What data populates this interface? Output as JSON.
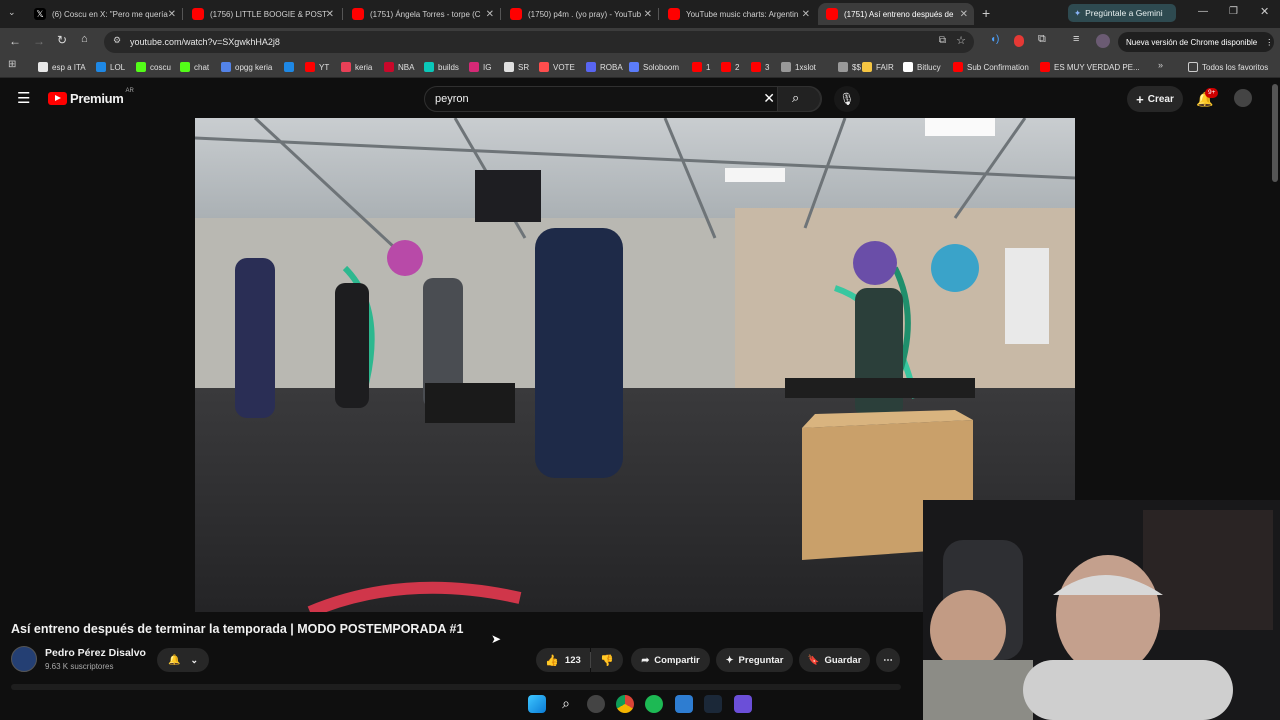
{
  "browser": {
    "tabs": [
      {
        "title": "(6) Coscu en X: \"Pero me quería",
        "favicon": "x-logo-icon"
      },
      {
        "title": "(1756) LITTLE BOOGIE & POST",
        "favicon": "youtube-icon"
      },
      {
        "title": "(1751) Ángela Torres - torpe (C",
        "favicon": "youtube-icon"
      },
      {
        "title": "(1750) p4m . (yo pray) - YouTub",
        "favicon": "youtube-icon"
      },
      {
        "title": "YouTube music charts: Argentin",
        "favicon": "youtube-icon"
      },
      {
        "title": "(1751) Así entreno después de",
        "favicon": "youtube-icon"
      }
    ],
    "gemini_label": "Pregúntale a Gemini",
    "url": "youtube.com/watch?v=SXgwkhHA2j8",
    "update_label": "Nueva versión de Chrome disponible",
    "bookmarks": [
      {
        "label": "esp a ITA",
        "color": "#e8e8e8"
      },
      {
        "label": "LOL",
        "color": "#1e88e5"
      },
      {
        "label": "coscu",
        "color": "#53fc18"
      },
      {
        "label": "chat",
        "color": "#53fc18"
      },
      {
        "label": "opgg keria",
        "color": "#5383e8"
      },
      {
        "label": "",
        "color": "#1e88e5"
      },
      {
        "label": "YT",
        "color": "#ff0000"
      },
      {
        "label": "keria",
        "color": "#e84057"
      },
      {
        "label": "NBA",
        "color": "#c9082a"
      },
      {
        "label": "builds",
        "color": "#0ac8b9"
      },
      {
        "label": "IG",
        "color": "#d62976"
      },
      {
        "label": "SR",
        "color": "#e0e0e0"
      },
      {
        "label": "VOTE",
        "color": "#ff4d4d"
      },
      {
        "label": "ROBA",
        "color": "#5865f2"
      },
      {
        "label": "Soloboom",
        "color": "#5b7cfa"
      },
      {
        "label": "1",
        "color": "#ff0000"
      },
      {
        "label": "2",
        "color": "#ff0000"
      },
      {
        "label": "3",
        "color": "#ff0000"
      },
      {
        "label": "1xslot",
        "color": "#999999"
      },
      {
        "label": "$$",
        "color": "#999999"
      },
      {
        "label": "FAIR",
        "color": "#f5c542"
      },
      {
        "label": "Bitlucy",
        "color": "#ffffff"
      },
      {
        "label": "Sub Confirmation",
        "color": "#ff0000"
      },
      {
        "label": "ES MUY VERDAD PE...",
        "color": "#ff0000"
      }
    ],
    "all_bookmarks_label": "Todos los favoritos"
  },
  "youtube": {
    "logo_text": "Premium",
    "logo_region": "AR",
    "search_value": "peyron",
    "create_label": "Crear",
    "notification_count": "9+",
    "video_title": "Así entreno después de terminar la temporada | MODO POSTEMPORADA #1",
    "channel_name": "Pedro Pérez Disalvo",
    "subscribers": "9.63 K suscriptores",
    "like_count": "123",
    "share_label": "Compartir",
    "ask_label": "Preguntar",
    "save_label": "Guardar"
  },
  "colors": {
    "youtube_red": "#ff0000",
    "background": "#0f0f0f",
    "pill": "#272727"
  }
}
